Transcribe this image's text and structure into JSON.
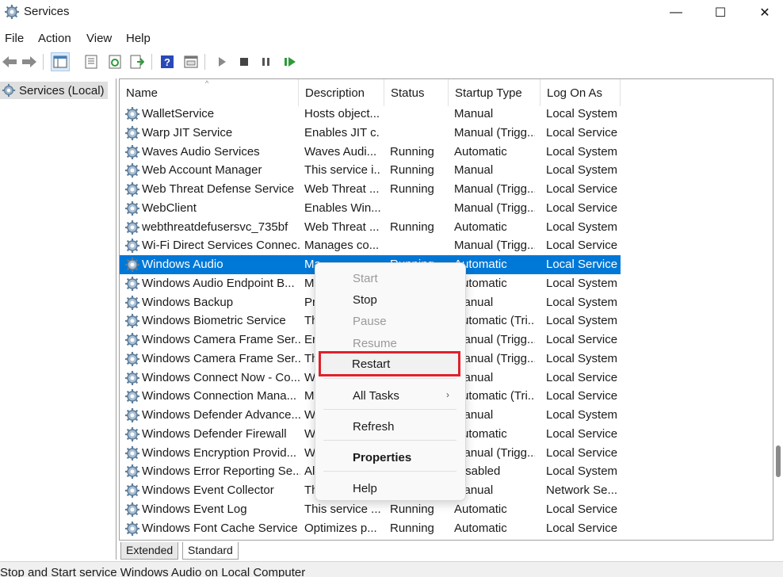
{
  "window": {
    "title": "Services",
    "minimize_glyph": "—",
    "maximize_glyph": "☐",
    "close_glyph": "✕"
  },
  "menu": [
    "File",
    "Action",
    "View",
    "Help"
  ],
  "toolbar": {
    "icons": [
      "back-icon",
      "forward-icon",
      "show-hide-console-tree-icon",
      "export-list-icon",
      "refresh-icon",
      "export-icon",
      "help-icon",
      "properties-icon",
      "start-service-icon",
      "stop-service-icon",
      "pause-service-icon",
      "restart-service-icon"
    ]
  },
  "tree": {
    "root_label": "Services (Local)"
  },
  "columns": {
    "name": "Name",
    "description": "Description",
    "status": "Status",
    "startup": "Startup Type",
    "logon": "Log On As"
  },
  "rows": [
    {
      "name": "WalletService",
      "description": "Hosts object...",
      "status": "",
      "startup": "Manual",
      "logon": "Local System"
    },
    {
      "name": "Warp JIT Service",
      "description": "Enables JIT c...",
      "status": "",
      "startup": "Manual (Trigg...",
      "logon": "Local Service"
    },
    {
      "name": "Waves Audio Services",
      "description": "Waves Audi...",
      "status": "Running",
      "startup": "Automatic",
      "logon": "Local System"
    },
    {
      "name": "Web Account Manager",
      "description": "This service i...",
      "status": "Running",
      "startup": "Manual",
      "logon": "Local System"
    },
    {
      "name": "Web Threat Defense Service",
      "description": "Web Threat ...",
      "status": "Running",
      "startup": "Manual (Trigg...",
      "logon": "Local Service"
    },
    {
      "name": "WebClient",
      "description": "Enables Win...",
      "status": "",
      "startup": "Manual (Trigg...",
      "logon": "Local Service"
    },
    {
      "name": "webthreatdefusersvc_735bf",
      "description": "Web Threat ...",
      "status": "Running",
      "startup": "Automatic",
      "logon": "Local System"
    },
    {
      "name": "Wi-Fi Direct Services Connec...",
      "description": "Manages co...",
      "status": "",
      "startup": "Manual (Trigg...",
      "logon": "Local Service"
    },
    {
      "name": "Windows Audio",
      "description": "Ma...",
      "status": "Running",
      "startup": "Automatic",
      "logon": "Local Service",
      "selected": true
    },
    {
      "name": "Windows Audio Endpoint B...",
      "description": "M",
      "status": "",
      "startup": "Automatic",
      "logon": "Local System"
    },
    {
      "name": "Windows Backup",
      "description": "Pr",
      "status": "",
      "startup": "Manual",
      "logon": "Local System"
    },
    {
      "name": "Windows Biometric Service",
      "description": "Th",
      "status": "",
      "startup": "Automatic (Tri...",
      "logon": "Local System"
    },
    {
      "name": "Windows Camera Frame Ser...",
      "description": "Er",
      "status": "",
      "startup": "Manual (Trigg...",
      "logon": "Local Service"
    },
    {
      "name": "Windows Camera Frame Ser...",
      "description": "Th",
      "status": "",
      "startup": "Manual (Trigg...",
      "logon": "Local System"
    },
    {
      "name": "Windows Connect Now - Co...",
      "description": "W",
      "status": "",
      "startup": "Manual",
      "logon": "Local Service"
    },
    {
      "name": "Windows Connection Mana...",
      "description": "M",
      "status": "",
      "startup": "Automatic (Tri...",
      "logon": "Local Service"
    },
    {
      "name": "Windows Defender Advance...",
      "description": "W",
      "status": "",
      "startup": "Manual",
      "logon": "Local System"
    },
    {
      "name": "Windows Defender Firewall",
      "description": "W",
      "status": "",
      "startup": "Automatic",
      "logon": "Local Service"
    },
    {
      "name": "Windows Encryption Provid...",
      "description": "W",
      "status": "",
      "startup": "Manual (Trigg...",
      "logon": "Local Service"
    },
    {
      "name": "Windows Error Reporting Se...",
      "description": "Al",
      "status": "",
      "startup": "Disabled",
      "logon": "Local System"
    },
    {
      "name": "Windows Event Collector",
      "description": "Th",
      "status": "",
      "startup": "Manual",
      "logon": "Network Se..."
    },
    {
      "name": "Windows Event Log",
      "description": "This service ...",
      "status": "Running",
      "startup": "Automatic",
      "logon": "Local Service"
    },
    {
      "name": "Windows Font Cache Service",
      "description": "Optimizes p...",
      "status": "Running",
      "startup": "Automatic",
      "logon": "Local Service"
    }
  ],
  "context_menu": {
    "start": "Start",
    "stop": "Stop",
    "pause": "Pause",
    "resume": "Resume",
    "restart": "Restart",
    "all_tasks": "All Tasks",
    "refresh": "Refresh",
    "properties": "Properties",
    "help": "Help"
  },
  "tabs": {
    "extended": "Extended",
    "standard": "Standard"
  },
  "status_bar": "Stop and Start service Windows Audio on Local Computer",
  "colors": {
    "selection": "#0078d7",
    "highlight_box": "#e0202b"
  }
}
